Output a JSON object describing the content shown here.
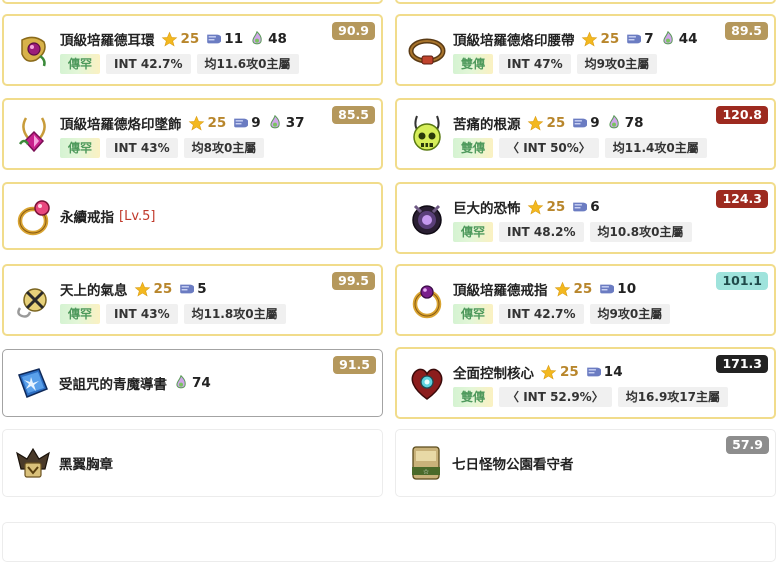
{
  "colors": {
    "card_border_gold": "#f1dc8b",
    "score_olive": "#b5985c",
    "score_red": "#9d2a1f",
    "score_teal": "#9fe3dc",
    "score_black": "#222222",
    "score_gray": "#8d8d8d",
    "star_color": "#f3b81f",
    "scroll_color": "#6b7cc2",
    "level_color": "#c0392b"
  },
  "items": [
    {
      "name": "頂級培羅德耳環",
      "star": "25",
      "scroll": "11",
      "flame": "48",
      "tier": "傳罕",
      "tags": [
        "INT 42.7%",
        "均11.6攻0主屬"
      ],
      "score": "90.9",
      "score_style": "olive",
      "icon": "earring-icon"
    },
    {
      "name": "頂級培羅德烙印腰帶",
      "star": "25",
      "scroll": "7",
      "flame": "44",
      "tier": "雙傳",
      "tags": [
        "INT 47%",
        "均9攻0主屬"
      ],
      "score": "89.5",
      "score_style": "olive",
      "icon": "belt-icon"
    },
    {
      "name": "頂級培羅德烙印墜飾",
      "star": "25",
      "scroll": "9",
      "flame": "37",
      "tier": "傳罕",
      "tags": [
        "INT 43%",
        "均8攻0主屬"
      ],
      "score": "85.5",
      "score_style": "olive",
      "icon": "pendant-icon"
    },
    {
      "name": "苦痛的根源",
      "star": "25",
      "scroll": "9",
      "flame": "78",
      "tier": "雙傳",
      "tags": [
        "〈 INT 50%〉",
        "均11.4攻0主屬"
      ],
      "score": "120.8",
      "score_style": "red",
      "icon": "skull-pendant-icon"
    },
    {
      "name": "永續戒指",
      "level": "[Lv.5]",
      "icon": "ring-icon"
    },
    {
      "name": "巨大的恐怖",
      "star": "25",
      "scroll": "6",
      "tier": "傳罕",
      "tags": [
        "INT 48.2%",
        "均10.8攻0主屬"
      ],
      "score": "124.3",
      "score_style": "red",
      "icon": "dark-ring-icon"
    },
    {
      "name": "天上的氣息",
      "star": "25",
      "scroll": "5",
      "tier": "傳罕",
      "tags": [
        "INT 43%",
        "均11.8攻0主屬"
      ],
      "score": "99.5",
      "score_style": "olive",
      "icon": "cross-pocket-icon"
    },
    {
      "name": "頂級培羅德戒指",
      "star": "25",
      "scroll": "10",
      "tier": "傳罕",
      "tags": [
        "INT 42.7%",
        "均9攻0主屬"
      ],
      "score": "101.1",
      "score_style": "teal",
      "icon": "gold-ring-icon"
    },
    {
      "name": "受詛咒的青魔導書",
      "flame": "74",
      "score": "91.5",
      "score_style": "olive",
      "icon": "blue-book-icon"
    },
    {
      "name": "全面控制核心",
      "star": "25",
      "scroll": "14",
      "tier": "雙傳",
      "tags": [
        "〈 INT 52.9%〉",
        "均16.9攻17主屬"
      ],
      "score": "171.3",
      "score_style": "black",
      "icon": "heart-core-icon"
    },
    {
      "name": "黑翼胸章",
      "icon": "badge-icon"
    },
    {
      "name": "七日怪物公園看守者",
      "score": "57.9",
      "score_style": "gray",
      "icon": "emblem-icon"
    }
  ]
}
